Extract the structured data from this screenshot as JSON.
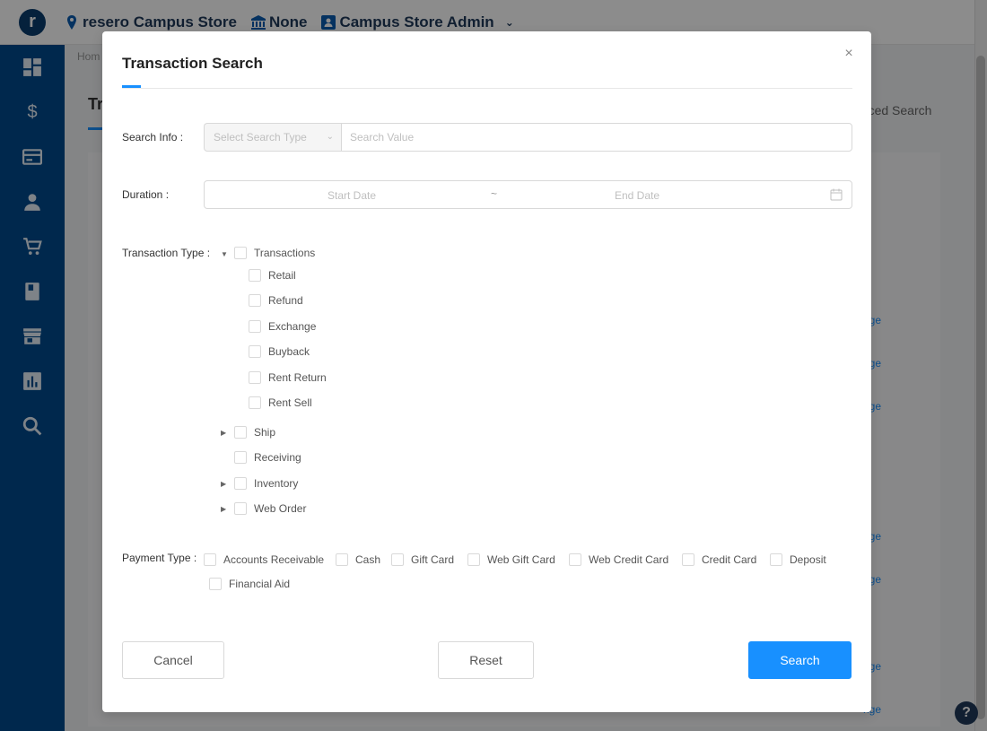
{
  "topbar": {
    "logo_letter": "r",
    "store_name": "resero Campus Store",
    "institution": "None",
    "role": "Campus Store Admin"
  },
  "sidebar": {
    "icons": [
      "dashboard-icon",
      "dollar-icon",
      "card-icon",
      "user-icon",
      "cart-icon",
      "book-icon",
      "store-icon",
      "report-icon",
      "search-icon"
    ],
    "dollar_glyph": "$"
  },
  "background": {
    "breadcrumb": "Hom",
    "page_title_fragment": "Tr",
    "advanced_search_fragment": "anced Search",
    "row_link_fragment": "nge",
    "help_glyph": "?"
  },
  "modal": {
    "title": "Transaction Search",
    "close_glyph": "×",
    "search_info": {
      "label": "Search Info :",
      "select_placeholder": "Select Search Type",
      "value_placeholder": "Search Value"
    },
    "duration": {
      "label": "Duration :",
      "start_placeholder": "Start Date",
      "separator": "~",
      "end_placeholder": "End Date"
    },
    "transaction_type": {
      "label": "Transaction Type :",
      "groups": [
        {
          "label": "Transactions",
          "expanded": true,
          "children": [
            "Retail",
            "Refund",
            "Exchange",
            "Buyback",
            "Rent Return",
            "Rent Sell"
          ]
        },
        {
          "label": "Ship",
          "expanded": false
        },
        {
          "label": "Receiving"
        },
        {
          "label": "Inventory",
          "expanded": false
        },
        {
          "label": "Web Order",
          "expanded": false
        }
      ]
    },
    "payment_type": {
      "label": "Payment Type :",
      "options": [
        "Accounts Receivable",
        "Cash",
        "Gift Card",
        "Web Gift Card",
        "Web Credit Card",
        "Credit Card",
        "Deposit",
        "Financial Aid"
      ]
    },
    "buttons": {
      "cancel": "Cancel",
      "reset": "Reset",
      "search": "Search"
    }
  }
}
